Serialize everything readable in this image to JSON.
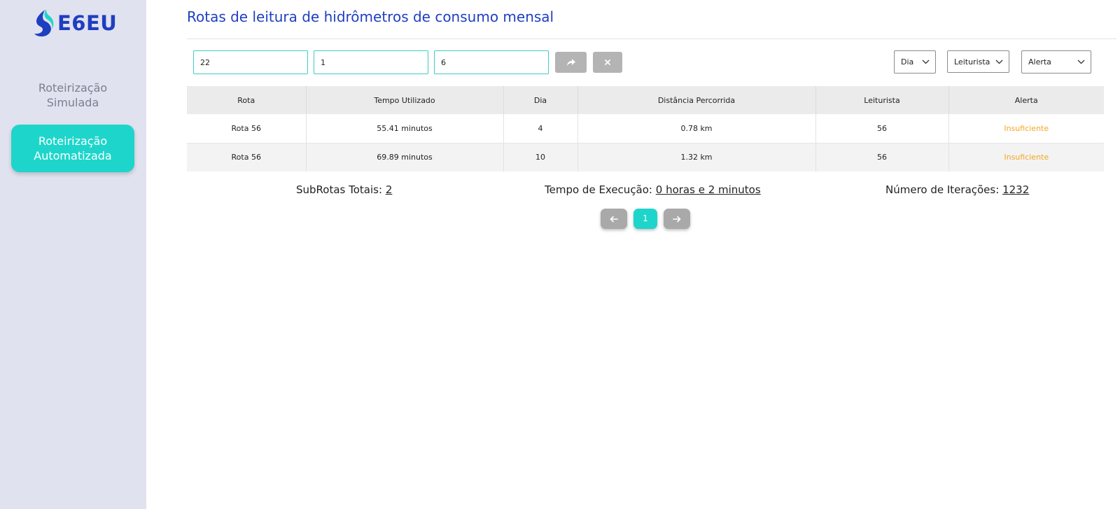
{
  "brand": {
    "name": "E6EU",
    "accent": "#1f3fc1",
    "teal": "#1ed5cb"
  },
  "sidebar": {
    "items": [
      {
        "label": "Roteirização Simulada",
        "active": false
      },
      {
        "label": "Roteirização Automatizada",
        "active": true
      }
    ]
  },
  "header": {
    "title": "Rotas de leitura de hidrômetros de consumo mensal"
  },
  "filters": {
    "inputs": [
      "22",
      "1",
      "6"
    ],
    "apply_icon": "share-arrow-icon",
    "clear_icon": "close-icon",
    "selects": [
      {
        "value": "Dia"
      },
      {
        "value": "Leiturista"
      },
      {
        "value": "Alerta"
      }
    ]
  },
  "table": {
    "columns": [
      "Rota",
      "Tempo Utilizado",
      "Dia",
      "Distância Percorrida",
      "Leiturista",
      "Alerta"
    ],
    "rows": [
      [
        "Rota 56",
        "55.41 minutos",
        "4",
        "0.78 km",
        "56",
        "Insuficiente"
      ],
      [
        "Rota 56",
        "69.89 minutos",
        "10",
        "1.32 km",
        "56",
        "Insuficiente"
      ]
    ],
    "alert_color": "#f5a623"
  },
  "stats": {
    "subrotas_label": "SubRotas Totais: ",
    "subrotas_value": "2",
    "tempo_label": "Tempo de Execução: ",
    "tempo_value": "0 horas e 2 minutos",
    "iteracoes_label": "Número de Iterações: ",
    "iteracoes_value": "1232"
  },
  "pagination": {
    "current": "1",
    "prev_icon": "arrow-left-icon",
    "next_icon": "arrow-right-icon"
  }
}
